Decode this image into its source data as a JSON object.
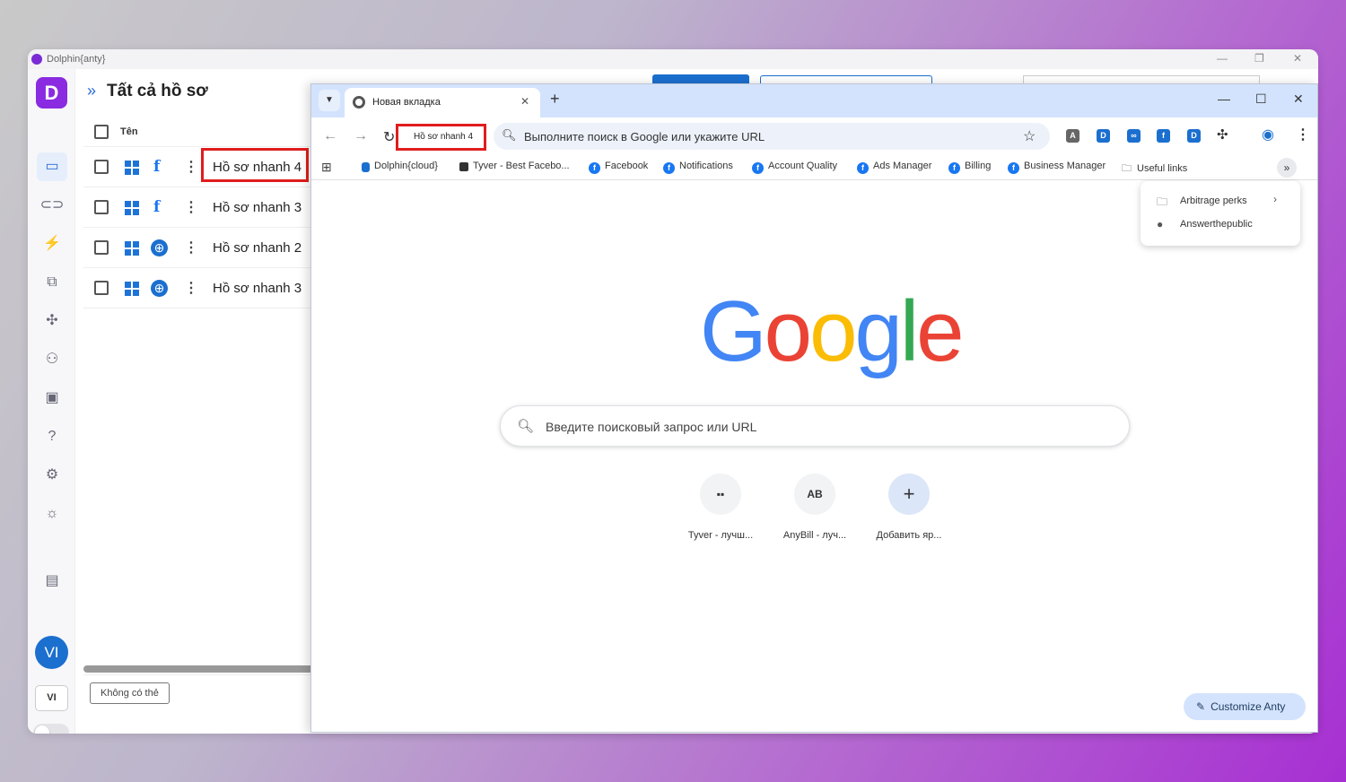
{
  "dolphin": {
    "window_title": "Dolphin{anty}",
    "logo_letter": "D",
    "header_title": "Tất cả hồ sơ",
    "column_name": "Tên",
    "profiles": [
      {
        "name": "Hồ sơ nhanh 4",
        "app": "facebook"
      },
      {
        "name": "Hồ sơ nhanh 3",
        "app": "facebook"
      },
      {
        "name": "Hồ sơ nhanh 2",
        "app": "browser"
      },
      {
        "name": "Hồ sơ nhanh 3",
        "app": "browser"
      }
    ],
    "bottom_button": "Không có thẻ",
    "avatar": "VI",
    "language": "VI"
  },
  "chrome": {
    "tab_title": "Новая вкладка",
    "profile_label": "Hồ sơ nhanh 4",
    "omnibox_placeholder": "Выполните поиск в Google или укажите URL",
    "bookmarks": [
      "Dolphin{cloud}",
      "Tyver - Best Facebo...",
      "Facebook",
      "Notifications",
      "Account Quality",
      "Ads Manager",
      "Billing",
      "Business Manager",
      "Useful links"
    ],
    "bookmark_overflow": [
      "Arbitrage perks",
      "Answerthepublic"
    ],
    "logo_text": "Google",
    "search_placeholder": "Введите поисковый запрос или URL",
    "shortcuts": [
      "Tyver - лучш...",
      "AnyBill - луч...",
      "Добавить яр..."
    ],
    "customize_button": "Customize Anty"
  },
  "colors": {
    "accent": "#1b6fcf",
    "highlight_box": "#e01d1d",
    "dolphin_brand": "#8a2be2"
  }
}
